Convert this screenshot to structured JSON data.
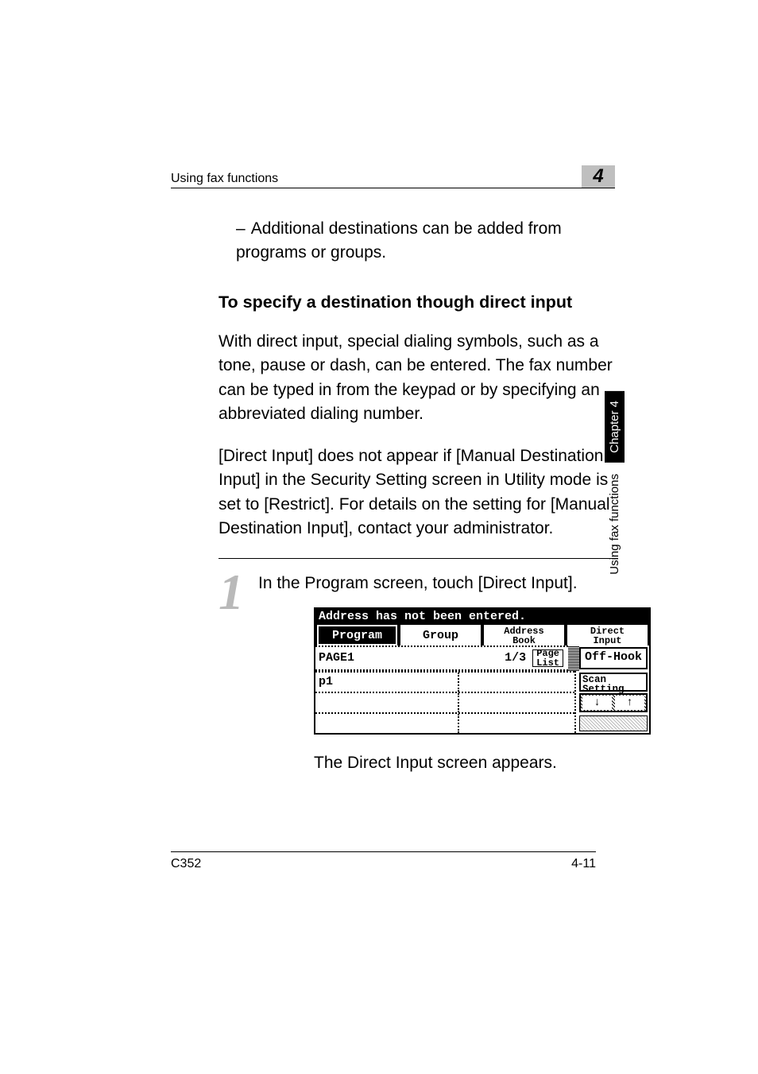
{
  "header": {
    "section": "Using fax functions",
    "chapter_number": "4"
  },
  "note": {
    "dash": "–",
    "text": "Additional destinations can be added from programs or groups."
  },
  "h2": "To specify a destination though direct input",
  "p1": "With direct input, special dialing symbols, such as a tone, pause or dash, can be entered. The fax number can be typed in from the keypad or by specifying an abbreviated dialing number.",
  "p2": "[Direct Input] does not appear if [Manual Destination Input] in the Security Setting screen in Utility mode is set to [Restrict]. For details on the setting for [Manual Destination Input], contact your administrator.",
  "step": {
    "num": "1",
    "text": "In the Program screen, touch [Direct Input]."
  },
  "shot": {
    "status": "Address has not been entered.",
    "tabs": {
      "program": "Program",
      "group": "Group",
      "addr1": "Address",
      "addr2": "Book",
      "direct1": "Direct",
      "direct2": "Input"
    },
    "page_label": "PAGE1",
    "page_count": "1/3",
    "pagelist1": "Page",
    "pagelist2": "List",
    "offhook": "Off-Hook",
    "p1": "p1",
    "scan1": "Scan",
    "scan2": "Setting",
    "down": "↓",
    "up": "↑"
  },
  "after": "The Direct Input screen appears.",
  "sidebar": {
    "black": "Chapter 4",
    "text": "Using fax functions"
  },
  "footer": {
    "model": "C352",
    "page": "4-11"
  }
}
